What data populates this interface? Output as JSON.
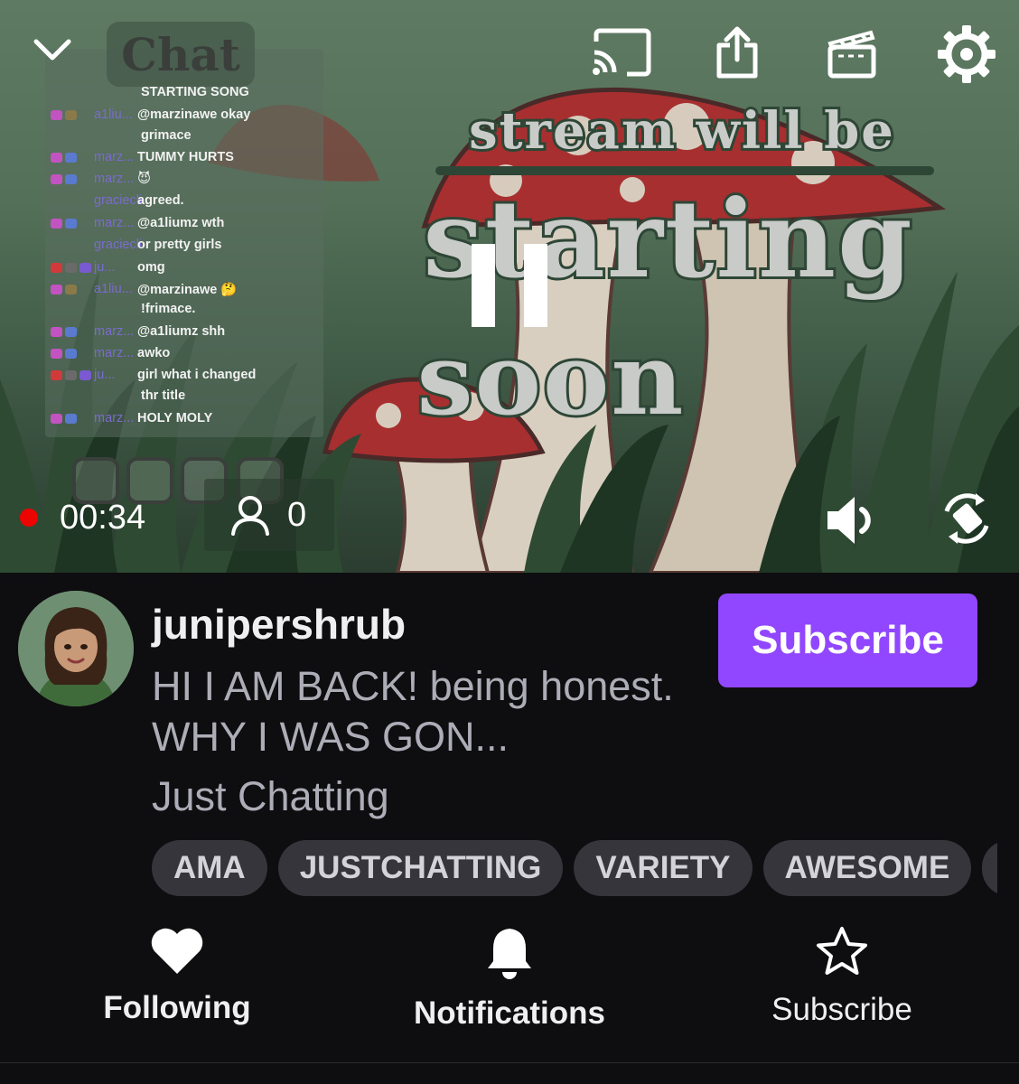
{
  "player": {
    "overlay": {
      "chat_heading": "Chat",
      "line1": "stream will be",
      "line2": "starting",
      "line3": "soon"
    },
    "chat": [
      {
        "user": "",
        "msg": "STARTING SONG",
        "badge_colors": []
      },
      {
        "user": "a1liu...",
        "msg": "@marzinawe okay",
        "badge_colors": [
          "#c154c1",
          "#8a7a4a"
        ]
      },
      {
        "user": "",
        "msg": "grimace",
        "badge_colors": []
      },
      {
        "user": "marz...",
        "msg": "TUMMY HURTS",
        "badge_colors": [
          "#c154c1",
          "#5a7ad0"
        ]
      },
      {
        "user": "marz...",
        "msg": "😈",
        "badge_colors": [
          "#c154c1",
          "#5a7ad0"
        ]
      },
      {
        "user": "gracieclill",
        "msg": "agreed.",
        "badge_colors": []
      },
      {
        "user": "marz...",
        "msg": "@a1liumz wth",
        "badge_colors": [
          "#c154c1",
          "#5a7ad0"
        ]
      },
      {
        "user": "gracieclill",
        "msg": "or pretty girls",
        "badge_colors": []
      },
      {
        "user": "ju...",
        "msg": "omg",
        "badge_colors": [
          "#d03a3a",
          "#6a6a6a",
          "#7a5ad0"
        ]
      },
      {
        "user": "a1liu...",
        "msg": "@marzinawe 🤔",
        "badge_colors": [
          "#c154c1",
          "#8a7a4a"
        ]
      },
      {
        "user": "",
        "msg": "!frimace.",
        "badge_colors": []
      },
      {
        "user": "marz...",
        "msg": "@a1liumz shh",
        "badge_colors": [
          "#c154c1",
          "#5a7ad0"
        ]
      },
      {
        "user": "marz...",
        "msg": "awko",
        "badge_colors": [
          "#c154c1",
          "#5a7ad0"
        ]
      },
      {
        "user": "ju...",
        "msg": "girl what i changed",
        "badge_colors": [
          "#d03a3a",
          "#6a6a6a",
          "#7a5ad0"
        ]
      },
      {
        "user": "",
        "msg": "thr title",
        "badge_colors": []
      },
      {
        "user": "marz...",
        "msg": "HOLY MOLY",
        "badge_colors": [
          "#c154c1",
          "#5a7ad0"
        ]
      }
    ],
    "social_handle": "@junipershrub",
    "elapsed": "00:34",
    "viewer_count": "0",
    "live_dot_color": "#eb0400"
  },
  "channel": {
    "name": "junipershrub",
    "title": "HI I AM BACK! being honest. WHY I WAS GON...",
    "category": "Just Chatting",
    "subscribe_label": "Subscribe",
    "accent": "#9147ff"
  },
  "tags": [
    "AMA",
    "JUSTCHATTING",
    "VARIETY",
    "AWESOME",
    ""
  ],
  "actions": {
    "following": "Following",
    "notifications": "Notifications",
    "subscribe": "Subscribe"
  },
  "icons": {
    "collapse": "chevron-down-icon",
    "cast": "cast-icon",
    "share": "share-icon",
    "clip": "clapperboard-icon",
    "settings": "gear-icon",
    "pause": "pause-icon",
    "volume": "volume-icon",
    "rotate": "rotate-screen-icon",
    "viewers": "person-icon",
    "following": "heart-icon",
    "notifications": "bell-icon",
    "subscribe": "star-icon"
  }
}
